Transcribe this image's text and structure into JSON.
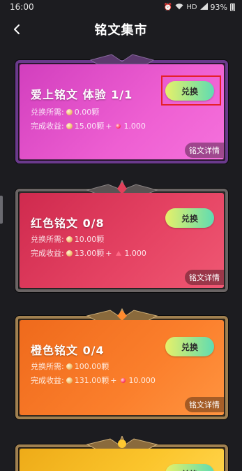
{
  "status_bar": {
    "time": "16:00",
    "network": "HD",
    "battery_pct": "93%"
  },
  "header": {
    "title": "铭文集市"
  },
  "cards": [
    {
      "title": "爱上铭文  体验 1/1",
      "cost_label": "兑换所需:",
      "cost_value": "0.00颗",
      "income_label": "完成收益:",
      "income_coin": "15.00颗",
      "plus": "+",
      "income_gem": "1.000",
      "button": "兑换",
      "detail": "铭文详情",
      "colors": {
        "panel_start": "#e04bc8",
        "panel_end": "#f36ad6",
        "frame": "#7b3aa0"
      }
    },
    {
      "title": "红色铭文 0/8",
      "cost_label": "兑换所需:",
      "cost_value": "10.00颗",
      "income_label": "完成收益:",
      "income_coin": "13.00颗",
      "plus": "+",
      "income_gem": "1.000",
      "button": "兑换",
      "detail": "铭文详情",
      "colors": {
        "panel_start": "#d52a52",
        "panel_end": "#ee4a6a",
        "frame": "#6d6a6a"
      }
    },
    {
      "title": "橙色铭文 0/4",
      "cost_label": "兑换所需:",
      "cost_value": "100.00颗",
      "income_label": "完成收益:",
      "income_coin": "131.00颗",
      "plus": "+",
      "income_gem": "10.000",
      "button": "兑换",
      "detail": "铭文详情",
      "colors": {
        "panel_start": "#f16b1f",
        "panel_end": "#ff8a34",
        "frame": "#a07c45"
      }
    },
    {
      "title": "",
      "button": "兑换",
      "colors": {
        "panel_start": "#f0b21a",
        "panel_end": "#ffd23a",
        "frame": "#a07c45"
      }
    }
  ]
}
